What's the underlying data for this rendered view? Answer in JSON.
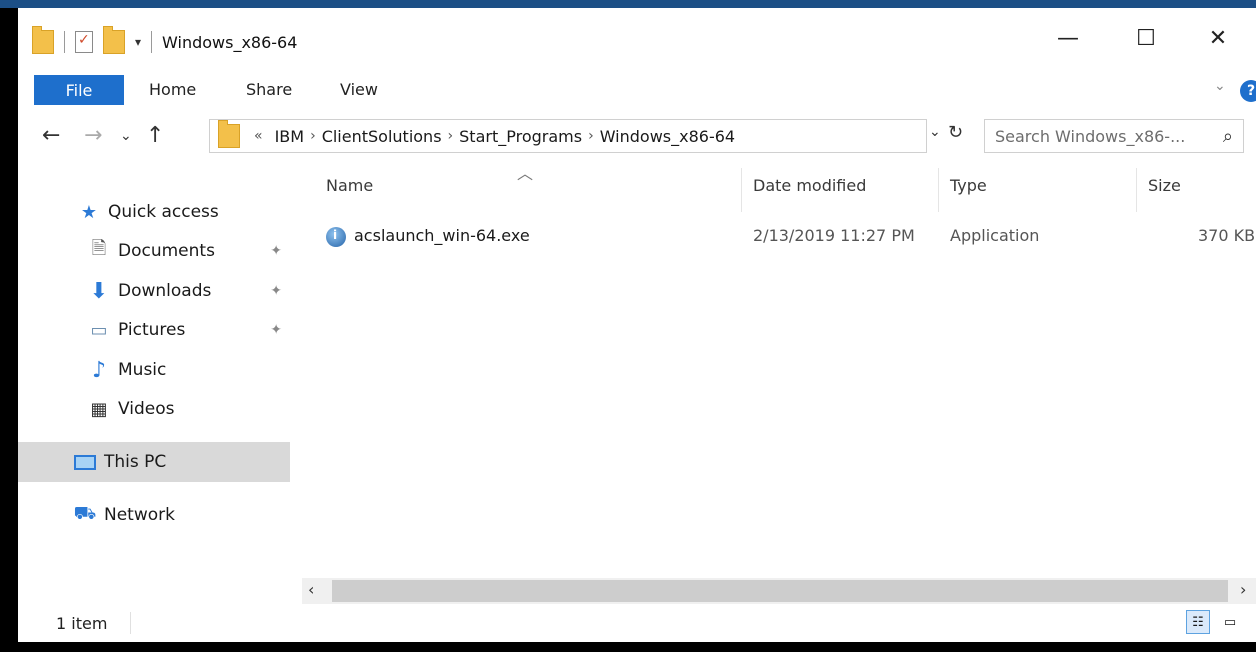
{
  "window": {
    "title": "Windows_x86-64",
    "controls": {
      "minimize": "—",
      "maximize": "☐",
      "close": "✕"
    }
  },
  "ribbon": {
    "file": "File",
    "tabs": [
      "Home",
      "Share",
      "View"
    ],
    "help": "?",
    "accent": "#1e6fcc"
  },
  "nav": {
    "back": "←",
    "forward": "→",
    "recent": "⌄",
    "up": "↑",
    "breadcrumb_overflow": "«",
    "breadcrumb": [
      "IBM",
      "ClientSolutions",
      "Start_Programs",
      "Windows_x86-64"
    ],
    "separator": "›",
    "search_placeholder": "Search Windows_x86-...",
    "refresh": "↻",
    "dropdown": "⌄"
  },
  "sidebar": {
    "quick_access": "Quick access",
    "items": [
      {
        "label": "Documents",
        "icon": "documents-icon",
        "pinned": true
      },
      {
        "label": "Downloads",
        "icon": "downloads-icon",
        "pinned": true
      },
      {
        "label": "Pictures",
        "icon": "pictures-icon",
        "pinned": true
      },
      {
        "label": "Music",
        "icon": "music-icon",
        "pinned": false
      },
      {
        "label": "Videos",
        "icon": "videos-icon",
        "pinned": false
      }
    ],
    "this_pc": "This PC",
    "network": "Network"
  },
  "columns": {
    "name": "Name",
    "date": "Date modified",
    "type": "Type",
    "size": "Size"
  },
  "files": [
    {
      "name": "acslaunch_win-64.exe",
      "date": "2/13/2019 11:27 PM",
      "type": "Application",
      "size": "370 KB"
    }
  ],
  "status": {
    "count": "1 item"
  }
}
